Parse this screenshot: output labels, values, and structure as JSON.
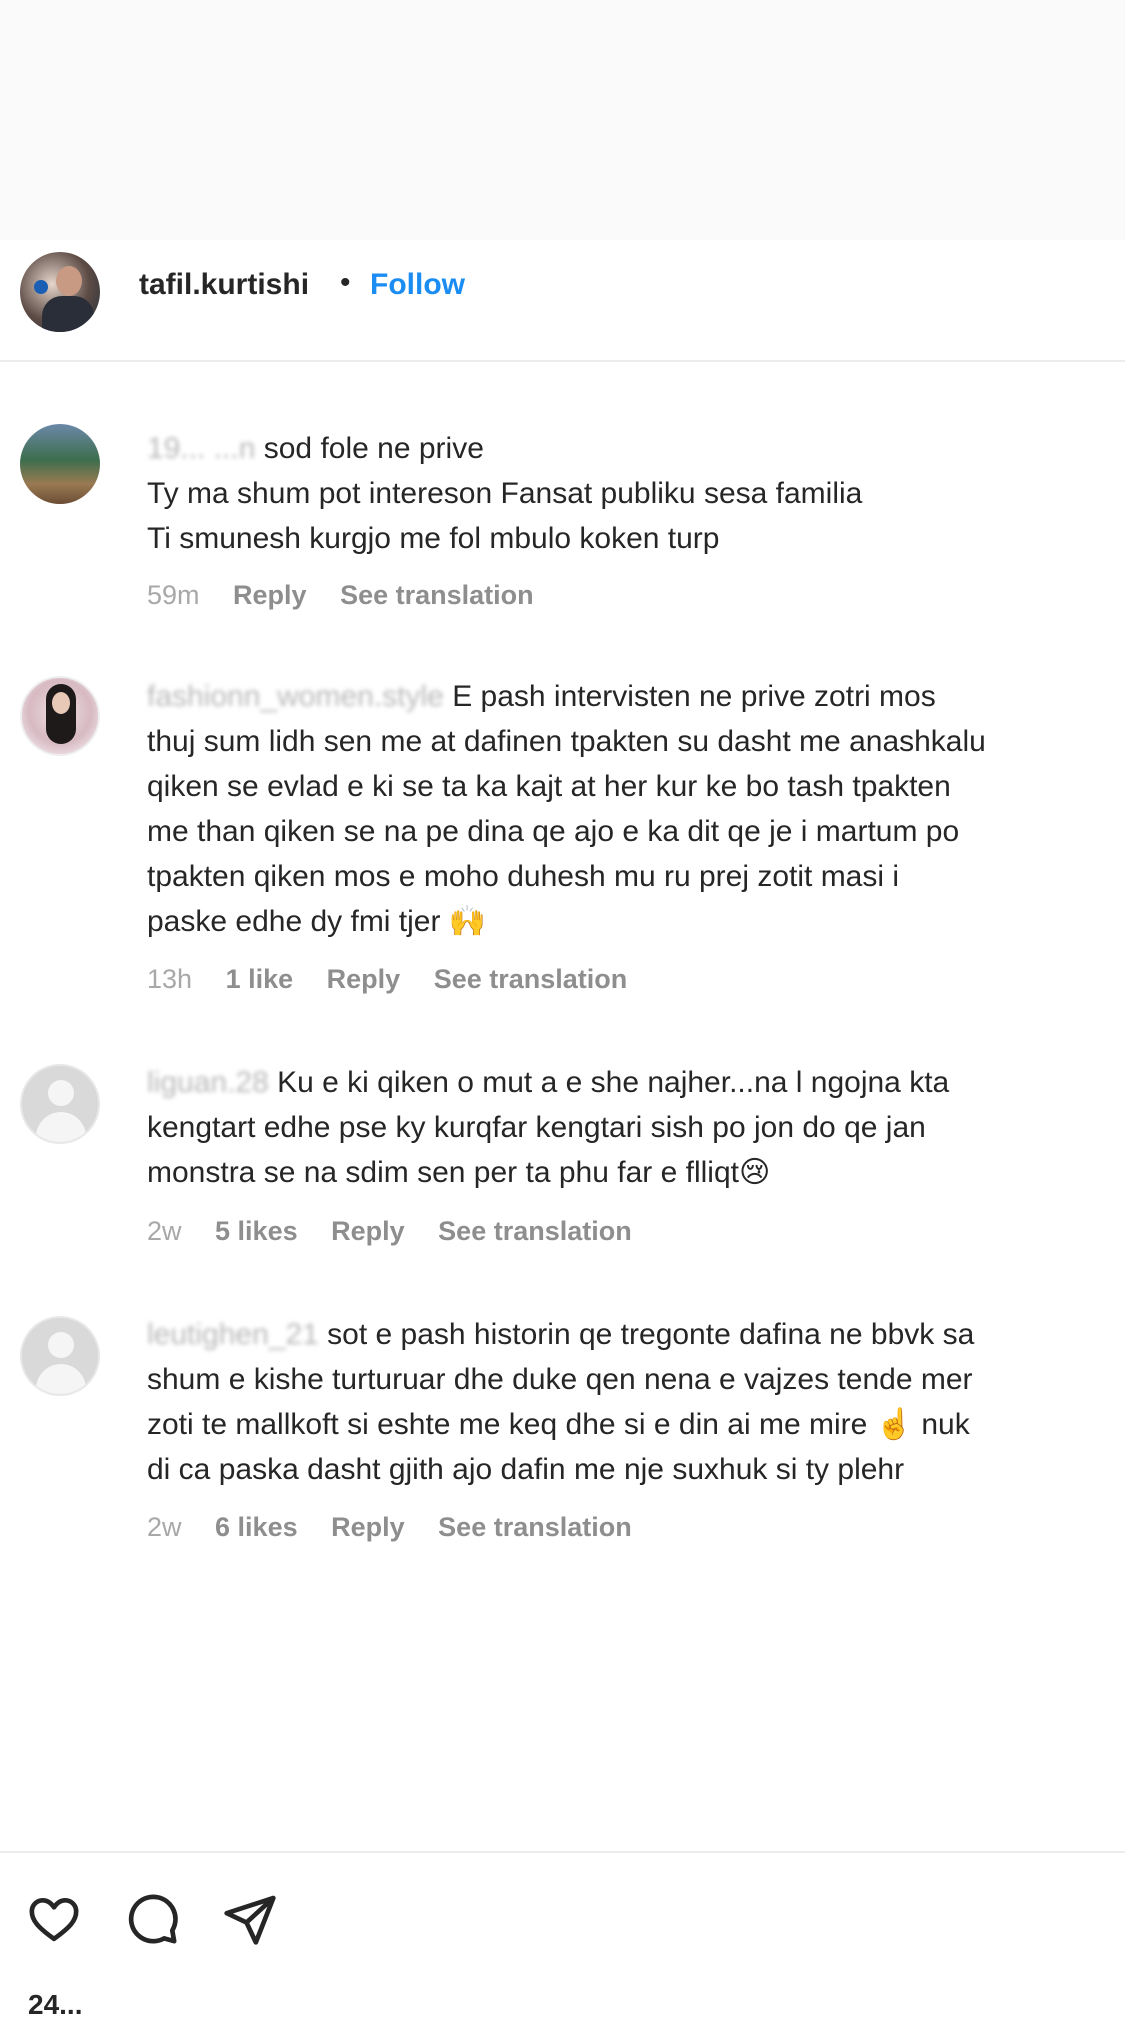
{
  "post_header": {
    "username": "tafil.kurtishi",
    "separator": "•",
    "follow_label": "Follow"
  },
  "comments": [
    {
      "username": "19... ...n",
      "lines": [
        "sod fole ne prive",
        "Ty ma shum pot intereson Fansat publiku sesa familia",
        "Ti smunesh kurgjo me fol mbulo koken turp"
      ],
      "time": "59m",
      "likes": "",
      "reply_label": "Reply",
      "translate_label": "See translation"
    },
    {
      "username": "fashionn_women.style",
      "lines": [
        "E pash intervisten ne prive zotri mos",
        "thuj sum lidh sen me at dafinen tpakten su dasht me anashkalu",
        "qiken se evlad e ki se ta ka kajt at her kur ke bo tash tpakten",
        "me than qiken se na pe dina qe ajo e ka dit qe je i martum po",
        "tpakten qiken mos e moho duhesh mu ru prej zotit masi i",
        "paske edhe dy fmi tjer 🙌"
      ],
      "time": "13h",
      "likes": "1 like",
      "reply_label": "Reply",
      "translate_label": "See translation"
    },
    {
      "username": "liguan.28",
      "lines": [
        "Ku e ki qiken o mut a e she najher...na l ngojna kta",
        "kengtart edhe pse ky kurqfar kengtari sish po jon do qe jan",
        "monstra se na sdim sen per ta phu far e flliqt😢"
      ],
      "time": "2w",
      "likes": "5 likes",
      "reply_label": "Reply",
      "translate_label": "See translation"
    },
    {
      "username": "leutighen_21",
      "lines": [
        "sot e pash historin qe tregonte dafina ne bbvk sa",
        "shum e kishe turturuar dhe duke qen nena e vajzes tende mer",
        "zoti te mallkoft si eshte me keq dhe si e din ai me mire ☝️ nuk",
        "di ca paska dasht gjith ajo dafin me nje suxhuk si ty plehr"
      ],
      "time": "2w",
      "likes": "6 likes",
      "reply_label": "Reply",
      "translate_label": "See translation"
    }
  ],
  "actions": {
    "like_icon": "heart-icon",
    "comment_icon": "comment-icon",
    "share_icon": "share-icon",
    "likes_count_partial": "24..."
  },
  "colors": {
    "accent": "#1a8cf2",
    "text": "#262626",
    "muted": "#a8a8a8",
    "divider": "#ececec"
  }
}
